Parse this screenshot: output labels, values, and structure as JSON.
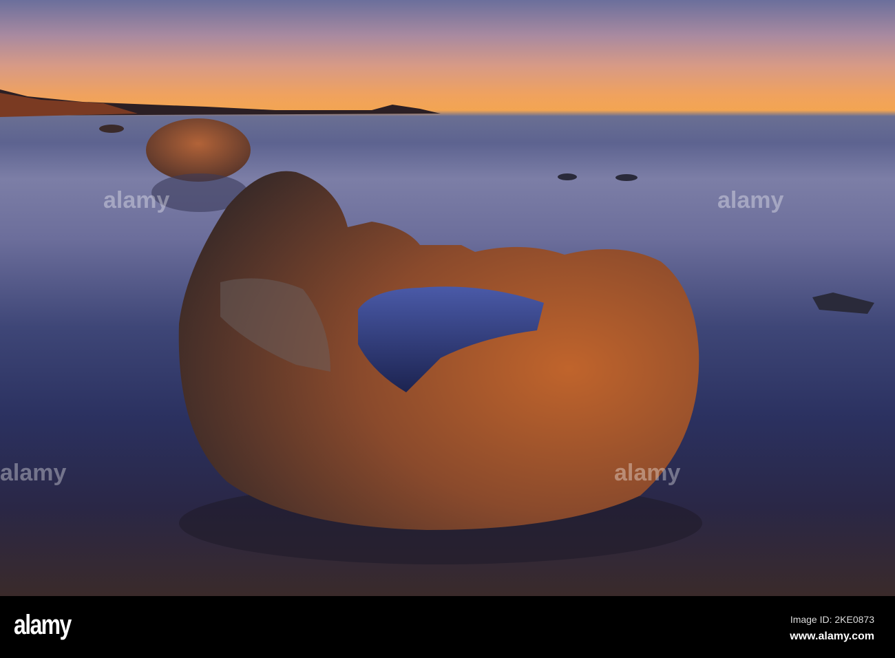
{
  "watermark": {
    "brand": "alamy"
  },
  "footer": {
    "logo": "alamy",
    "image_id": "Image ID: 2KE0873",
    "url": "www.alamy.com"
  }
}
